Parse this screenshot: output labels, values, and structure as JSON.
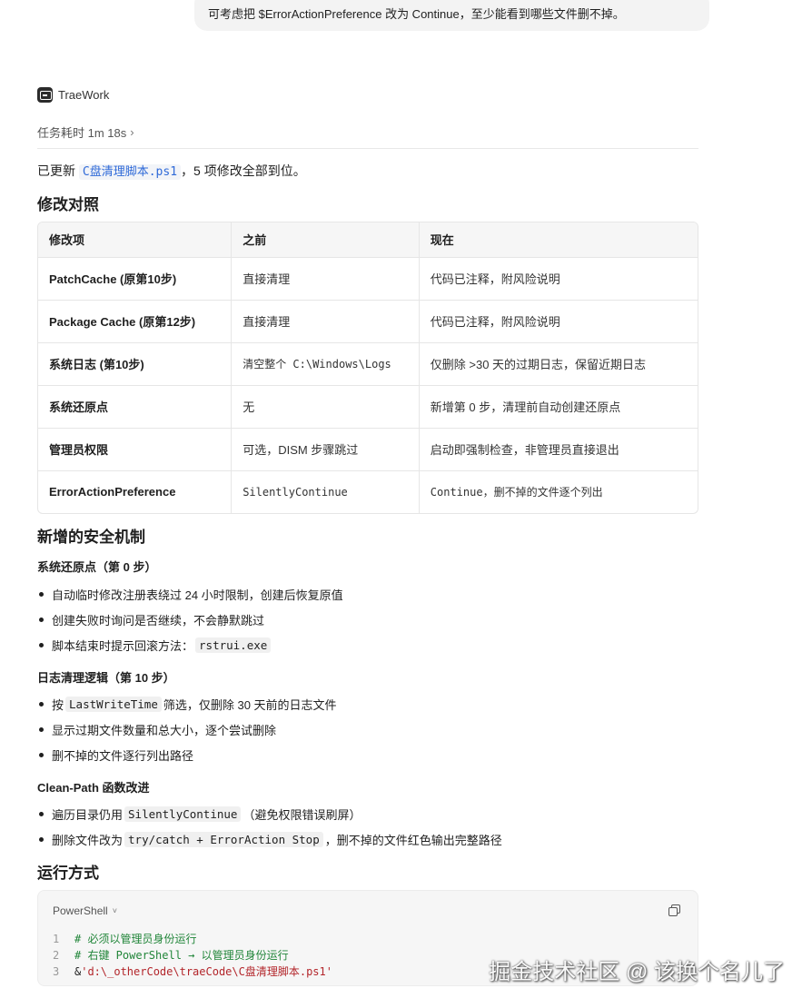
{
  "top_bubble": {
    "text": "可考虑把 $ErrorActionPreference 改为 Continue，至少能看到哪些文件删不掉。"
  },
  "agent": {
    "name": "TraeWork",
    "icon": "terminal-icon"
  },
  "duration": {
    "label": "任务耗时 1m 18s",
    "chevron": "›"
  },
  "summary": {
    "prefix": "已更新 ",
    "file": "C盘清理脚本.ps1",
    "suffix": "，5 项修改全部到位。"
  },
  "sections": {
    "comparison_title": "修改对照",
    "safety_title": "新增的安全机制",
    "run_title": "运行方式"
  },
  "table": {
    "headers": [
      "修改项",
      "之前",
      "现在"
    ],
    "rows": [
      [
        "PatchCache (原第10步)",
        "直接清理",
        "代码已注释，附风险说明"
      ],
      [
        "Package Cache (原第12步)",
        "直接清理",
        "代码已注释，附风险说明"
      ],
      [
        "系统日志 (第10步)",
        "清空整个 C:\\Windows\\Logs",
        "仅删除 >30 天的过期日志，保留近期日志"
      ],
      [
        "系统还原点",
        "无",
        "新增第 0 步，清理前自动创建还原点"
      ],
      [
        "管理员权限",
        "可选，DISM 步骤跳过",
        "启动即强制检查，非管理员直接退出"
      ],
      [
        "ErrorActionPreference",
        "SilentlyContinue",
        "Continue，删不掉的文件逐个列出"
      ]
    ]
  },
  "safety": {
    "restore": {
      "title": "系统还原点（第 0 步）",
      "items": [
        {
          "text": "自动临时修改注册表绕过 24 小时限制，创建后恢复原值"
        },
        {
          "text": "创建失败时询问是否继续，不会静默跳过"
        },
        {
          "pre": "脚本结束时提示回滚方法：",
          "code": "rstrui.exe",
          "post": ""
        }
      ]
    },
    "logs": {
      "title": "日志清理逻辑（第 10 步）",
      "items": [
        {
          "pre": "按",
          "code": "LastWriteTime",
          "post": "筛选，仅删除 30 天前的日志文件"
        },
        {
          "text": "显示过期文件数量和总大小，逐个尝试删除"
        },
        {
          "text": "删不掉的文件逐行列出路径"
        }
      ]
    },
    "cleanpath": {
      "title": "Clean-Path 函数改进",
      "items": [
        {
          "pre": "遍历目录仍用",
          "code": "SilentlyContinue",
          "post": "（避免权限错误刷屏）"
        },
        {
          "pre": "删除文件改为",
          "code": "try/catch + ErrorAction Stop",
          "post": "，删不掉的文件红色输出完整路径"
        }
      ]
    }
  },
  "code_block": {
    "language": "PowerShell",
    "chevron": "˅",
    "copy_icon": "copy-icon",
    "lines": [
      {
        "n": "1",
        "text": "# 必须以管理员身份运行"
      },
      {
        "n": "2",
        "text": "# 右键 PowerShell → 以管理员身份运行"
      },
      {
        "n": "3",
        "op": "& ",
        "text": "'d:\\_otherCode\\traeCode\\C盘清理脚本.ps1'"
      }
    ]
  },
  "watermark": {
    "text": "掘金技术社区 @ 该换个名儿了"
  }
}
